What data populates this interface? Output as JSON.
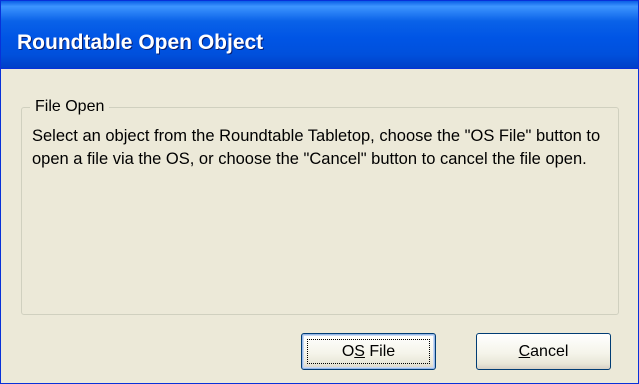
{
  "window": {
    "title": "Roundtable Open Object"
  },
  "group": {
    "legend": "File Open",
    "message": "Select an object from the Roundtable Tabletop, choose the \"OS File\" button to open a file via the OS, or choose the \"Cancel\" button to cancel the file open."
  },
  "buttons": {
    "os_file": {
      "label": "OS File",
      "mnemonic": "S"
    },
    "cancel": {
      "label": "Cancel",
      "mnemonic": "C"
    }
  },
  "colors": {
    "titlebar": "#0055e5",
    "dialog_bg": "#ece9d8",
    "title_text": "#ffffff"
  }
}
